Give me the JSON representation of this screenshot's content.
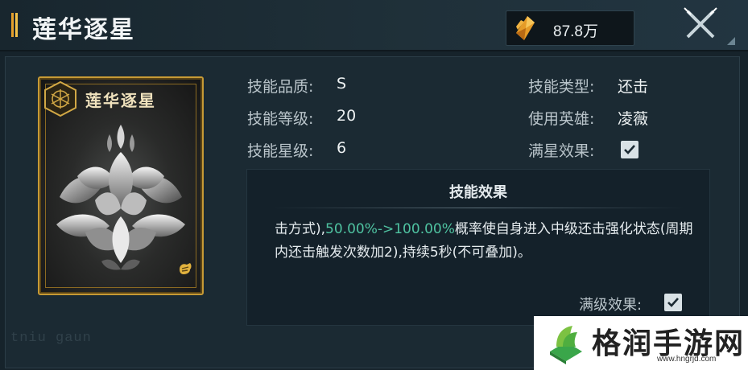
{
  "header": {
    "title": "莲华逐星",
    "currency_amount": "87.8万",
    "currency_icon": "crystal-icon",
    "close_icon": "close-icon"
  },
  "card": {
    "title": "莲华逐星",
    "emblem_icon": "hex-emblem-icon",
    "art": "silver-lotus",
    "corner_icon": "hand-icon",
    "frame_color": "#c79a35"
  },
  "skill_info": {
    "quality": {
      "label": "技能品质:",
      "value": "S"
    },
    "level": {
      "label": "技能等级:",
      "value": "20"
    },
    "star": {
      "label": "技能星级:",
      "value": "6"
    },
    "type": {
      "label": "技能类型:",
      "value": "还击"
    },
    "hero": {
      "label": "使用英雄:",
      "value": "凌薇"
    },
    "max_star": {
      "label": "满星效果:",
      "checked": true
    }
  },
  "effect": {
    "title": "技能效果",
    "text_before": "击方式),",
    "highlight": "50.00%->100.00%",
    "text_after": "概率使自身进入中级还击强化状态(周期内还击触发次数加2),持续5秒(不可叠加)。",
    "highlight_color": "#4fc3a1",
    "max_level": {
      "label": "满级效果:",
      "checked": true
    }
  },
  "watermark": {
    "title": "格润手游网",
    "url": "www.hngrjd.com"
  },
  "faint_logo": "tniu gaun"
}
